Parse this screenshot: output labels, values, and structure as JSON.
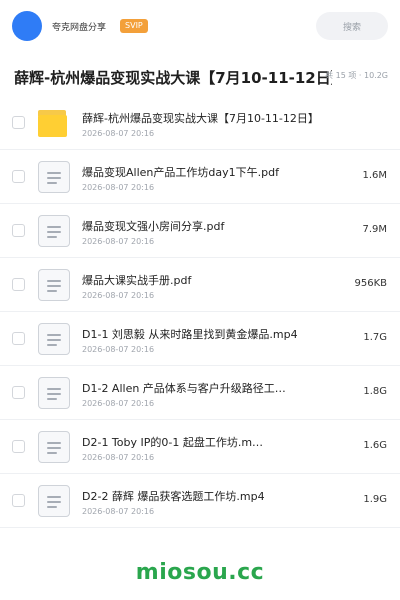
{
  "header": {
    "user_name": "夸克网盘分享",
    "badge": "SVIP",
    "search_label": "搜索"
  },
  "page": {
    "title": "薛辉-杭州爆品变现实战大课【7月10-11-12日】",
    "meta": "共 15 项 · 10.2G"
  },
  "files": [
    {
      "type": "folder",
      "name": "薛辉-杭州爆品变现实战大课【7月10-11-12日】",
      "date": "2026-08-07 20:16",
      "size": ""
    },
    {
      "type": "doc",
      "name": "爆品变现Allen产品工作坊day1下午.pdf",
      "date": "2026-08-07 20:16",
      "size": "1.6M"
    },
    {
      "type": "doc",
      "name": "爆品变现文强小房间分享.pdf",
      "date": "2026-08-07 20:16",
      "size": "7.9M"
    },
    {
      "type": "doc",
      "name": "爆品大课实战手册.pdf",
      "date": "2026-08-07 20:16",
      "size": "956KB"
    },
    {
      "type": "doc",
      "name": "D1-1  刘思毅  从来时路里找到黄金爆品.mp4",
      "date": "2026-08-07 20:16",
      "size": "1.7G"
    },
    {
      "type": "doc",
      "name": "D1-2  Allen  产品体系与客户升级路径工…",
      "date": "2026-08-07 20:16",
      "size": "1.8G"
    },
    {
      "type": "doc",
      "name": "D2-1 Toby  IP的0-1 起盘工作坊.m…",
      "date": "2026-08-07 20:16",
      "size": "1.6G"
    },
    {
      "type": "doc",
      "name": "D2-2  薛辉  爆品获客选题工作坊.mp4",
      "date": "2026-08-07 20:16",
      "size": "1.9G"
    }
  ],
  "watermark": "miosou.cc",
  "colors": {
    "avatar": "#2f7cf6",
    "badge": "#f3a03a",
    "folder": "#ffcf33",
    "watermark": "#2aa64d"
  }
}
